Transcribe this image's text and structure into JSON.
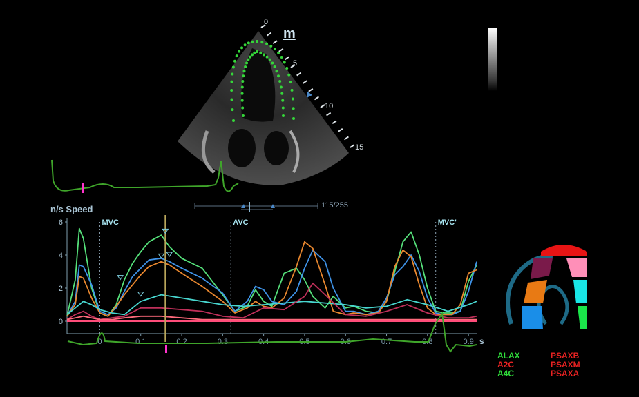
{
  "colors": {
    "ecg": "#3fa52a",
    "axis": "#7f9fb0",
    "text_cyan": "#a9e6f2",
    "marker_magenta": "#ff33cc",
    "tracking_dots": "#35d63a",
    "cursor_line": "#b8a55a"
  },
  "echo": {
    "depth_labels": [
      "0",
      "5",
      "10",
      "15"
    ],
    "probe_mark": "m"
  },
  "frame_slider": {
    "value_text": "115/255",
    "frame": 115,
    "total": 255
  },
  "chart": {
    "axis_title": "n/s Speed",
    "y_ticks": [
      "6",
      "4",
      "2",
      "0"
    ],
    "x_ticks": [
      "0",
      "0.1",
      "0.2",
      "0.3",
      "0.4",
      "0.5",
      "0.6",
      "0.7",
      "0.8",
      "0.9"
    ],
    "x_unit": "s",
    "events": [
      {
        "label": "MVC",
        "x": 0.0
      },
      {
        "label": "AVC",
        "x": 0.32
      },
      {
        "label": "MVC'",
        "x": 0.82
      }
    ]
  },
  "chart_data": {
    "type": "line",
    "ylabel": "n/s Speed",
    "xlabel": "s",
    "xlim": [
      -0.08,
      0.92
    ],
    "ylim": [
      0,
      6
    ],
    "series": [
      {
        "color": "#55e07a",
        "x": [
          -0.08,
          -0.06,
          -0.05,
          -0.04,
          -0.02,
          0.0,
          0.02,
          0.04,
          0.06,
          0.08,
          0.1,
          0.12,
          0.15,
          0.17,
          0.2,
          0.25,
          0.3,
          0.33,
          0.36,
          0.38,
          0.4,
          0.42,
          0.45,
          0.48,
          0.5,
          0.52,
          0.55,
          0.57,
          0.6,
          0.62,
          0.65,
          0.68,
          0.7,
          0.72,
          0.74,
          0.76,
          0.78,
          0.8,
          0.82,
          0.84,
          0.86,
          0.88,
          0.9,
          0.92
        ],
        "values": [
          0.3,
          2.5,
          5.6,
          5.0,
          2.0,
          0.5,
          0.3,
          1.0,
          2.5,
          3.5,
          4.2,
          4.8,
          5.2,
          4.5,
          3.8,
          3.2,
          1.6,
          0.6,
          0.9,
          1.9,
          1.2,
          0.9,
          2.9,
          3.2,
          2.5,
          1.5,
          0.8,
          1.5,
          0.8,
          0.9,
          0.6,
          0.5,
          1.2,
          3.0,
          4.8,
          5.4,
          4.0,
          2.0,
          0.6,
          0.5,
          0.5,
          0.6,
          2.4,
          3.4
        ]
      },
      {
        "color": "#3f93e8",
        "x": [
          -0.08,
          -0.06,
          -0.05,
          -0.04,
          -0.02,
          0.0,
          0.02,
          0.04,
          0.06,
          0.08,
          0.1,
          0.12,
          0.15,
          0.17,
          0.2,
          0.25,
          0.3,
          0.33,
          0.36,
          0.38,
          0.4,
          0.42,
          0.45,
          0.48,
          0.5,
          0.52,
          0.55,
          0.57,
          0.6,
          0.62,
          0.65,
          0.68,
          0.7,
          0.72,
          0.74,
          0.76,
          0.78,
          0.8,
          0.82,
          0.84,
          0.86,
          0.88,
          0.9,
          0.92
        ],
        "values": [
          0.3,
          1.2,
          3.4,
          3.3,
          2.2,
          0.6,
          0.4,
          0.8,
          1.8,
          2.7,
          3.2,
          3.7,
          3.8,
          3.6,
          3.2,
          2.6,
          1.7,
          0.6,
          1.2,
          2.1,
          1.9,
          1.2,
          1.0,
          1.8,
          3.2,
          4.3,
          3.6,
          2.0,
          0.6,
          0.6,
          0.4,
          0.6,
          1.4,
          2.8,
          3.3,
          4.0,
          3.0,
          1.4,
          0.5,
          0.4,
          0.4,
          0.6,
          1.8,
          3.6
        ]
      },
      {
        "color": "#e8872f",
        "x": [
          -0.08,
          -0.06,
          -0.05,
          -0.04,
          -0.02,
          0.0,
          0.02,
          0.04,
          0.06,
          0.08,
          0.1,
          0.12,
          0.15,
          0.17,
          0.2,
          0.25,
          0.3,
          0.33,
          0.36,
          0.38,
          0.4,
          0.42,
          0.45,
          0.48,
          0.5,
          0.52,
          0.55,
          0.57,
          0.6,
          0.62,
          0.65,
          0.68,
          0.7,
          0.72,
          0.74,
          0.76,
          0.78,
          0.8,
          0.82,
          0.84,
          0.86,
          0.88,
          0.9,
          0.92
        ],
        "values": [
          0.3,
          1.0,
          2.7,
          2.6,
          1.4,
          0.5,
          0.3,
          0.9,
          1.6,
          2.2,
          2.8,
          3.3,
          3.6,
          3.4,
          2.9,
          2.1,
          1.2,
          0.5,
          0.8,
          1.2,
          0.9,
          0.8,
          1.4,
          3.3,
          4.8,
          4.4,
          2.2,
          0.6,
          0.4,
          0.5,
          0.4,
          0.5,
          1.2,
          3.3,
          4.3,
          3.9,
          2.2,
          0.8,
          0.4,
          0.4,
          0.4,
          1.0,
          2.9,
          3.1
        ]
      },
      {
        "color": "#48d6cf",
        "x": [
          -0.08,
          -0.06,
          -0.04,
          -0.02,
          0.0,
          0.03,
          0.06,
          0.1,
          0.15,
          0.2,
          0.25,
          0.3,
          0.35,
          0.4,
          0.45,
          0.5,
          0.55,
          0.6,
          0.65,
          0.7,
          0.75,
          0.8,
          0.85,
          0.9,
          0.92
        ],
        "values": [
          0.4,
          0.8,
          1.2,
          1.0,
          0.7,
          0.5,
          0.4,
          1.2,
          1.6,
          1.4,
          1.2,
          1.0,
          0.9,
          1.0,
          1.1,
          1.2,
          1.1,
          1.0,
          0.8,
          0.9,
          1.3,
          1.0,
          0.6,
          1.0,
          1.2
        ]
      },
      {
        "color": "#c0305a",
        "x": [
          -0.08,
          -0.06,
          -0.04,
          -0.02,
          0.0,
          0.03,
          0.06,
          0.1,
          0.15,
          0.2,
          0.25,
          0.3,
          0.35,
          0.4,
          0.45,
          0.5,
          0.52,
          0.55,
          0.6,
          0.65,
          0.7,
          0.75,
          0.8,
          0.85,
          0.9,
          0.92
        ],
        "values": [
          0.1,
          0.4,
          0.6,
          0.3,
          0.1,
          0.2,
          0.3,
          0.8,
          0.8,
          0.7,
          0.6,
          0.3,
          0.2,
          0.8,
          0.7,
          1.5,
          2.3,
          1.6,
          0.4,
          0.3,
          0.6,
          1.0,
          0.5,
          0.2,
          0.2,
          0.3
        ]
      },
      {
        "color": "#ff6a7c",
        "x": [
          -0.08,
          -0.06,
          -0.04,
          -0.02,
          0.0,
          0.03,
          0.06,
          0.1,
          0.15,
          0.2,
          0.25,
          0.3,
          0.35,
          0.4,
          0.45,
          0.5,
          0.55,
          0.6,
          0.65,
          0.7,
          0.75,
          0.8,
          0.85,
          0.9,
          0.92
        ],
        "values": [
          0.1,
          0.2,
          0.3,
          0.2,
          0.1,
          0.1,
          0.2,
          0.3,
          0.3,
          0.2,
          0.1,
          0.1,
          0.1,
          0.1,
          0.1,
          0.1,
          0.1,
          0.1,
          0.1,
          0.1,
          0.1,
          0.1,
          0.1,
          0.1,
          0.1
        ]
      }
    ]
  },
  "views": {
    "left": [
      {
        "label": "ALAX",
        "color": "#2fdc3a"
      },
      {
        "label": "A2C",
        "color": "#e82222"
      },
      {
        "label": "A4C",
        "color": "#2fdc3a"
      }
    ],
    "right": [
      {
        "label": "PSAXB",
        "color": "#e82222"
      },
      {
        "label": "PSAXM",
        "color": "#e82222"
      },
      {
        "label": "PSAXA",
        "color": "#e82222"
      }
    ]
  }
}
